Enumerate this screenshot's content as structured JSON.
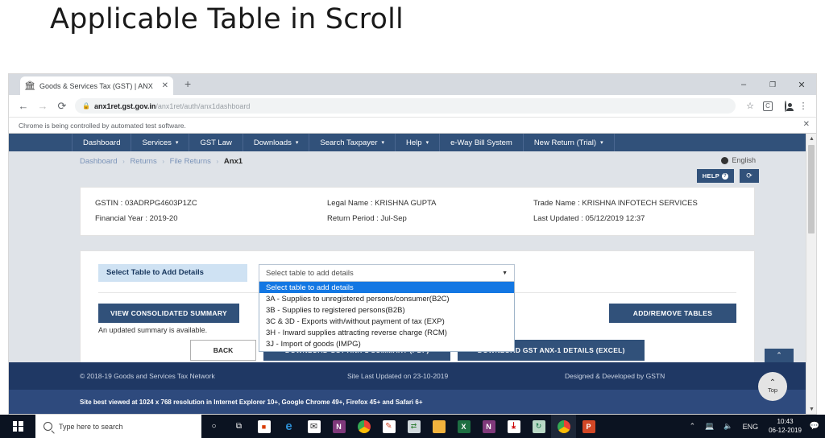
{
  "slide": {
    "title": "Applicable Table in Scroll"
  },
  "browser": {
    "tab": {
      "title": "Goods & Services Tax (GST) | ANX",
      "favicon": "gst-favicon",
      "close": "✕"
    },
    "newtab_label": "+",
    "window_controls": {
      "minimize": "–",
      "maximize": "❐",
      "close": "✕"
    },
    "nav": {
      "back": "←",
      "forward": "→",
      "reload": "⟳"
    },
    "omnibox": {
      "lock": "🔒",
      "url_domain": "anx1ret.gst.gov.in",
      "url_path": "/anx1ret/auth/anx1dashboard",
      "star": "☆"
    },
    "extension_badge": "C",
    "menu": "⋮",
    "infobar": {
      "text": "Chrome is being controlled by automated test software.",
      "close": "✕"
    }
  },
  "gstnav": {
    "items": [
      {
        "label": "Dashboard",
        "caret": false
      },
      {
        "label": "Services",
        "caret": true
      },
      {
        "label": "GST Law",
        "caret": false
      },
      {
        "label": "Downloads",
        "caret": true
      },
      {
        "label": "Search Taxpayer",
        "caret": true
      },
      {
        "label": "Help",
        "caret": true
      },
      {
        "label": "e-Way Bill System",
        "caret": false
      },
      {
        "label": "New Return (Trial)",
        "caret": true
      }
    ],
    "caret_glyph": "▾"
  },
  "breadcrumb": {
    "items": [
      "Dashboard",
      "Returns",
      "File Returns"
    ],
    "current": "Anx1",
    "separator": "›"
  },
  "language": {
    "label": "English",
    "icon": "globe-icon"
  },
  "help": {
    "label": "HELP",
    "badge": "?",
    "refresh_icon": "⟳"
  },
  "taxpayer_info": {
    "gstin_label": "GSTIN :",
    "gstin_value": "03ADRPG4603P1ZC",
    "legal_name_label": "Legal Name :",
    "legal_name_value": "KRISHNA GUPTA",
    "trade_name_label": "Trade Name :",
    "trade_name_value": "KRISHNA INFOTECH SERVICES",
    "financial_year_label": "Financial Year :",
    "financial_year_value": "2019-20",
    "return_period_label": "Return Period :",
    "return_period_value": "Jul-Sep",
    "last_updated_label": "Last Updated :",
    "last_updated_value": "05/12/2019 12:37"
  },
  "select_table": {
    "label": "Select Table to Add Details",
    "selected_value": "Select table to add details",
    "arrow": "▼",
    "options": [
      "Select table to add details",
      "3A - Supplies to unregistered persons/consumer(B2C)",
      "3B - Supplies to registered persons(B2B)",
      "3C & 3D - Exports with/without payment of tax (EXP)",
      "3H - Inward supplies attracting reverse charge (RCM)",
      "3J - Import of goods (IMPG)"
    ],
    "selected_index": 0
  },
  "actions": {
    "view_consolidated_summary": "VIEW CONSOLIDATED SUMMARY",
    "add_remove_tables": "ADD/REMOVE TABLES",
    "updated_note": "An updated summary is available.",
    "back": "BACK",
    "download_pdf": "DOWNLOAD GST ANX-1 SUMMARY (PDF)",
    "download_excel": "DOWNLOAD GST ANX-1 DETAILS (EXCEL)"
  },
  "footer": {
    "copyright": "© 2018-19 Goods and Services Tax Network",
    "last_updated": "Site Last Updated on 23-10-2019",
    "developed_by": "Designed & Developed by GSTN",
    "best_viewed": "Site best viewed at 1024 x 768 resolution in Internet Explorer 10+, Google Chrome 49+, Firefox 45+ and Safari 6+"
  },
  "scroll_top": {
    "label": "Top",
    "chevron": "⌃"
  },
  "taskbar": {
    "start_icon": "windows-logo",
    "search_placeholder": "Type here to search",
    "cortana_icon": "○",
    "taskview_icon": "⧉",
    "pinned": [
      {
        "name": "microsoft-store-icon",
        "glyph": "🛍",
        "color": "#ffffff"
      },
      {
        "name": "edge-icon",
        "glyph": "e",
        "color": "#1b8ac4"
      },
      {
        "name": "mail-icon",
        "glyph": "✉",
        "color": "#ffffff"
      },
      {
        "name": "onenote-icon",
        "glyph": "N",
        "color": "#80397b"
      },
      {
        "name": "chrome-icon",
        "glyph": "●",
        "color": "#4285f4"
      },
      {
        "name": "paint-icon",
        "glyph": "✎",
        "color": "#d24726"
      },
      {
        "name": "file-transfer-icon",
        "glyph": "⮌",
        "color": "#3b7a57"
      },
      {
        "name": "file-explorer-icon",
        "glyph": "🗁",
        "color": "#f2b33d"
      },
      {
        "name": "excel-icon",
        "glyph": "X",
        "color": "#1d6f42"
      },
      {
        "name": "onenote2-icon",
        "glyph": "N",
        "color": "#80397b"
      },
      {
        "name": "adobe-reader-icon",
        "glyph": "A",
        "color": "#cc0000"
      },
      {
        "name": "teamviewer-icon",
        "glyph": "⟳",
        "color": "#0e8ee9"
      },
      {
        "name": "chrome-active-icon",
        "glyph": "●",
        "color": "#4285f4"
      },
      {
        "name": "powerpoint-icon",
        "glyph": "P",
        "color": "#d24726"
      }
    ],
    "tray": {
      "chevron": "⌃",
      "network": "🖵",
      "volume": "🔊",
      "language": "ENG",
      "time": "10:43",
      "date": "06-12-2019",
      "action_center": "🖥"
    }
  }
}
